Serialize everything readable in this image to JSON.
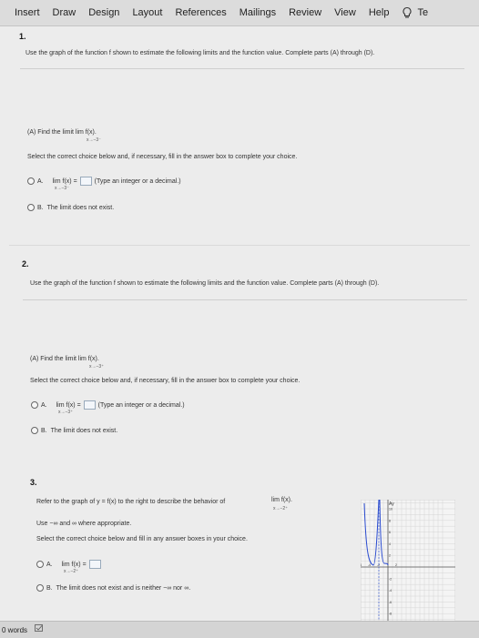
{
  "ribbon": {
    "tabs": [
      "Insert",
      "Draw",
      "Design",
      "Layout",
      "References",
      "Mailings",
      "Review",
      "View",
      "Help"
    ],
    "tell_me": "Te"
  },
  "q1": {
    "number": "1.",
    "prompt": "Use the graph of the function f shown to estimate the following limits and the function value. Complete parts (A) through (D).",
    "part": "(A) Find the limit   lim   f(x).",
    "part_sub": "x→−3⁻",
    "instruction": "Select the correct choice below and, if necessary, fill in the answer box to complete your choice.",
    "option_a_letter": "A.",
    "option_a_expr": "lim   f(x) =",
    "option_a_sub": "x→−3⁻",
    "option_a_hint": "(Type an integer or a decimal.)",
    "option_b_letter": "B.",
    "option_b_text": "The limit does not exist."
  },
  "q2": {
    "number": "2.",
    "prompt": "Use the graph of the function f shown to estimate the following limits and the function value. Complete parts (A) through (D).",
    "part": "(A) Find the limit   lim   f(x).",
    "part_sub": "x→−3⁺",
    "instruction": "Select the correct choice below and, if necessary, fill in the answer box to complete your choice.",
    "option_a_letter": "A.",
    "option_a_expr": "lim   f(x) =",
    "option_a_sub": "x→−3⁺",
    "option_a_hint": "(Type an integer or a decimal.)",
    "option_b_letter": "B.",
    "option_b_text": "The limit does not exist."
  },
  "q3": {
    "number": "3.",
    "prompt": "Refer to the graph of y = f(x) to the right to describe the behavior of",
    "prompt_lim": "lim   f(x).",
    "prompt_sub": "x→−2⁺",
    "hint": "Use −∞ and ∞ where appropriate.",
    "instruction": "Select the correct choice below and fill in any answer boxes in your choice.",
    "option_a_letter": "A.",
    "option_a_expr": "lim   f(x) =",
    "option_a_sub": "x→−2⁺",
    "option_b_letter": "B.",
    "option_b_text": "The limit does not exist and is neither −∞ nor ∞."
  },
  "graph": {
    "y_label": "Ay",
    "x_ticks": [
      "-10",
      "-8",
      "-6",
      "-4",
      "-2",
      "2"
    ],
    "y_ticks": [
      "10",
      "8",
      "6",
      "4",
      "2",
      "-2",
      "-4",
      "-6",
      "-8",
      "-10"
    ]
  },
  "status": {
    "words": "0 words"
  },
  "colors": {
    "ribbon": "#dcdcdc",
    "page": "#ececec",
    "status": "#d4d4d4"
  }
}
